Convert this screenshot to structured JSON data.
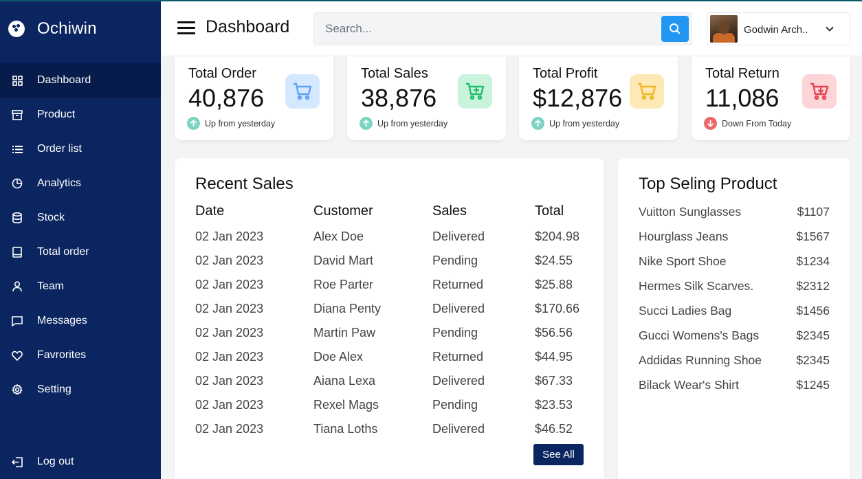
{
  "brand": {
    "name": "Ochiwin"
  },
  "sidebar": {
    "items": [
      {
        "label": "Dashboard",
        "icon": "grid-icon",
        "active": true
      },
      {
        "label": "Product",
        "icon": "archive-icon"
      },
      {
        "label": "Order list",
        "icon": "list-icon"
      },
      {
        "label": "Analytics",
        "icon": "pie-chart-icon"
      },
      {
        "label": "Stock",
        "icon": "database-icon"
      },
      {
        "label": "Total order",
        "icon": "tablet-icon"
      },
      {
        "label": "Team",
        "icon": "user-icon"
      },
      {
        "label": "Messages",
        "icon": "message-icon"
      },
      {
        "label": "Favrorites",
        "icon": "heart-icon"
      },
      {
        "label": "Setting",
        "icon": "gear-icon"
      }
    ],
    "logout": {
      "label": "Log out",
      "icon": "logout-icon"
    }
  },
  "header": {
    "title": "Dashboard",
    "search_placeholder": "Search...",
    "profile_name": "Godwin Arch.."
  },
  "stats": [
    {
      "title": "Total Order",
      "value": "40,876",
      "trend": "Up from yesterday",
      "direction": "up",
      "icon": "cart-icon",
      "icon_bg": "#d6e8ff",
      "icon_color": "#5aa2f5"
    },
    {
      "title": "Total Sales",
      "value": "38,876",
      "trend": "Up from yesterday",
      "direction": "up",
      "icon": "cart-plus-icon",
      "icon_bg": "#c9f3dc",
      "icon_color": "#1fbf6a"
    },
    {
      "title": "Total Profit",
      "value": "$12,876",
      "trend": "Up from yesterday",
      "direction": "up",
      "icon": "cart-icon",
      "icon_bg": "#fde9b5",
      "icon_color": "#f0b429"
    },
    {
      "title": "Total Return",
      "value": "11,086",
      "trend": "Down From Today",
      "direction": "down",
      "icon": "cart-down-icon",
      "icon_bg": "#fbd5d8",
      "icon_color": "#e8424f"
    }
  ],
  "colors": {
    "sidebar_bg": "#0b2560",
    "accent": "#2196f3",
    "trend_up": "#7fd3c4",
    "trend_down": "#ea6b6b"
  },
  "recent_sales": {
    "title": "Recent Sales",
    "columns": [
      "Date",
      "Customer",
      "Sales",
      "Total"
    ],
    "rows": [
      [
        "02 Jan 2023",
        "Alex Doe",
        "Delivered",
        "$204.98"
      ],
      [
        "02 Jan 2023",
        "David Mart",
        "Pending",
        "$24.55"
      ],
      [
        "02 Jan 2023",
        "Roe Parter",
        "Returned",
        "$25.88"
      ],
      [
        "02 Jan 2023",
        "Diana Penty",
        "Delivered",
        "$170.66"
      ],
      [
        "02 Jan 2023",
        "Martin Paw",
        "Pending",
        "$56.56"
      ],
      [
        "02 Jan 2023",
        "Doe Alex",
        "Returned",
        "$44.95"
      ],
      [
        "02 Jan 2023",
        "Aiana Lexa",
        "Delivered",
        "$67.33"
      ],
      [
        "02 Jan 2023",
        "Rexel Mags",
        "Pending",
        "$23.53"
      ],
      [
        "02 Jan 2023",
        "Tiana Loths",
        "Delivered",
        "$46.52"
      ]
    ],
    "see_all_label": "See All"
  },
  "top_selling": {
    "title": "Top Seling Product",
    "items": [
      {
        "name": "Vuitton Sunglasses",
        "price": "$1107"
      },
      {
        "name": "Hourglass Jeans",
        "price": "$1567"
      },
      {
        "name": "Nike Sport Shoe",
        "price": "$1234"
      },
      {
        "name": "Hermes Silk Scarves.",
        "price": "$2312"
      },
      {
        "name": "Succi Ladies Bag",
        "price": "$1456"
      },
      {
        "name": "Gucci Womens's Bags",
        "price": "$2345"
      },
      {
        "name": "Addidas Running Shoe",
        "price": "$2345"
      },
      {
        "name": "Bilack Wear's Shirt",
        "price": "$1245"
      }
    ]
  }
}
